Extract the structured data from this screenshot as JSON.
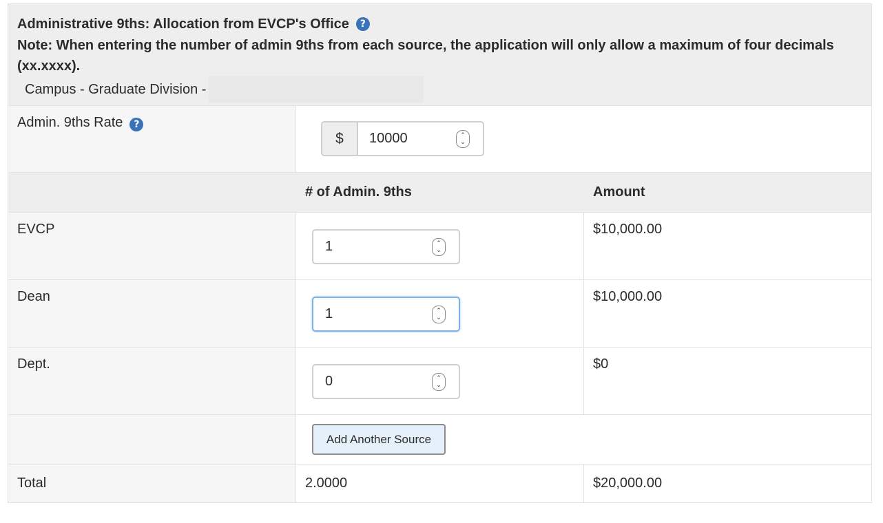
{
  "header": {
    "title": "Administrative 9ths: Allocation from EVCP's Office",
    "help_glyph": "?",
    "note": "Note: When entering the number of admin 9ths from each source, the application will only allow a maximum of four decimals (xx.xxxx).",
    "campus_prefix": "Campus - Graduate Division -"
  },
  "rate": {
    "label": "Admin. 9ths Rate",
    "currency_symbol": "$",
    "value": "10000"
  },
  "table": {
    "col_count_header": "# of Admin. 9ths",
    "col_amount_header": "Amount",
    "rows": [
      {
        "label": "EVCP",
        "count": "1",
        "amount": "$10,000.00"
      },
      {
        "label": "Dean",
        "count": "1",
        "amount": "$10,000.00"
      },
      {
        "label": "Dept.",
        "count": "0",
        "amount": "$0"
      }
    ],
    "add_button": "Add Another Source",
    "total_label": "Total",
    "total_count": "2.0000",
    "total_amount": "$20,000.00"
  },
  "icons": {
    "help": "question-circle-icon",
    "spinner": "number-spinner-icon"
  },
  "colors": {
    "help_icon": "#3a73b8",
    "focus_border": "#7fb1e6",
    "button_bg": "#e6f0fa"
  }
}
